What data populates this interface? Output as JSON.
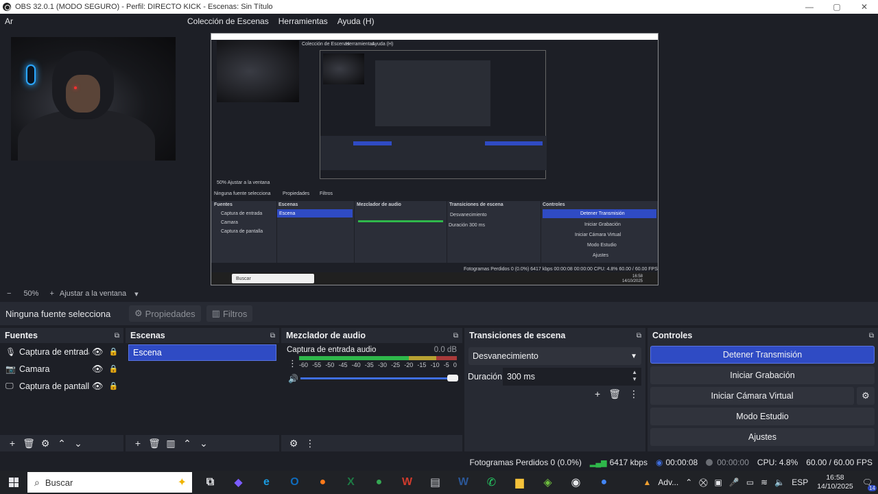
{
  "window": {
    "title": "OBS 32.0.1 (MODO SEGURO) - Perfil: DIRECTO KICK - Escenas: Sin Título",
    "minimize": "—",
    "maximize": "▢",
    "close": "✕"
  },
  "menu": {
    "items": [
      "Ar",
      "Colección de Escenas",
      "Herramientas",
      "Ayuda (H)"
    ]
  },
  "preview": {
    "nested": {
      "menu": [
        "Colección de Escenas",
        "Herramientas",
        "Ayuda (H)"
      ],
      "no_source": "Ninguna fuente selecciona",
      "properties": "Propiedades",
      "filters": "Filtros",
      "docks": [
        "Fuentes",
        "Escenas",
        "Mezclador de audio",
        "Transiciones de escena",
        "Controles"
      ],
      "sources": [
        "Captura de entrada",
        "Camara",
        "Captura de pantalla"
      ],
      "scene": "Escena",
      "controls": [
        "Detener Transmisión",
        "Iniciar Grabación",
        "Iniciar Cámara Virtual",
        "Modo Estudio",
        "Ajustes"
      ],
      "transition": "Desvanecimiento",
      "duration_label": "Duración",
      "duration": "300 ms",
      "search": "Buscar",
      "status": "Fotogramas Perdidos 0 (0.0%)   6417 kbps   00:00:08   00:00:00   CPU: 4.8%   60.00 / 60.00 FPS",
      "zoom": "50%   Ajustar a la ventana",
      "clock_time": "16:58",
      "clock_date": "14/10/2025"
    }
  },
  "zoom": {
    "minus": "−",
    "level": "50%",
    "plus": "+",
    "fit": "Ajustar a la ventana",
    "arrow": "▾"
  },
  "source_bar": {
    "no_source": "Ninguna fuente selecciona",
    "properties": "Propiedades",
    "filters": "Filtros"
  },
  "docks": {
    "sources": {
      "title": "Fuentes",
      "items": [
        {
          "name": "Captura de entrada audio",
          "icon": "microphone-icon"
        },
        {
          "name": "Camara",
          "icon": "camera-icon"
        },
        {
          "name": "Captura de pantalla",
          "icon": "monitor-icon"
        }
      ]
    },
    "scenes": {
      "title": "Escenas",
      "items": [
        "Escena"
      ]
    },
    "mixer": {
      "title": "Mezclador de audio",
      "channel": "Captura de entrada audio",
      "db": "0.0 dB",
      "scale": [
        "-60",
        "-55",
        "-50",
        "-45",
        "-40",
        "-35",
        "-30",
        "-25",
        "-20",
        "-15",
        "-10",
        "-5",
        "0"
      ],
      "level": 0.78
    },
    "transitions": {
      "title": "Transiciones de escena",
      "selected": "Desvanecimiento",
      "duration_label": "Duración",
      "duration": "300 ms"
    },
    "controls": {
      "title": "Controles",
      "stop_stream": "Detener Transmisión",
      "start_recording": "Iniciar Grabación",
      "start_virtual_cam": "Iniciar Cámara Virtual",
      "studio_mode": "Modo Estudio",
      "settings": "Ajustes"
    }
  },
  "status": {
    "dropped_frames": "Fotogramas Perdidos 0 (0.0%)",
    "bitrate": "6417 kbps",
    "stream_time": "00:00:08",
    "record_time": "00:00:00",
    "cpu": "CPU: 4.8%",
    "fps": "60.00 / 60.00 FPS"
  },
  "taskbar": {
    "search_placeholder": "Buscar",
    "apps": [
      {
        "name": "task-view",
        "glyph": "⧉",
        "color": "#e6e7ea"
      },
      {
        "name": "copilot",
        "glyph": "◆",
        "color": "#7b5cff"
      },
      {
        "name": "edge",
        "glyph": "e",
        "color": "#1a9be0"
      },
      {
        "name": "outlook",
        "glyph": "O",
        "color": "#0f6cbd"
      },
      {
        "name": "firefox",
        "glyph": "●",
        "color": "#ff7a1a"
      },
      {
        "name": "excel",
        "glyph": "X",
        "color": "#1d7a44"
      },
      {
        "name": "chrome",
        "glyph": "●",
        "color": "#35a853"
      },
      {
        "name": "office",
        "glyph": "W",
        "color": "#d13b2c"
      },
      {
        "name": "files",
        "glyph": "▤",
        "color": "#c8cacf"
      },
      {
        "name": "word",
        "glyph": "W",
        "color": "#2b5797"
      },
      {
        "name": "whatsapp",
        "glyph": "✆",
        "color": "#25d366"
      },
      {
        "name": "explorer",
        "glyph": "▆",
        "color": "#f5c23a"
      },
      {
        "name": "layers-app",
        "glyph": "◈",
        "color": "#6fbf3f"
      },
      {
        "name": "obs",
        "glyph": "◉",
        "color": "#e6e7ea"
      },
      {
        "name": "chrome-2",
        "glyph": "●",
        "color": "#4285f4"
      }
    ],
    "warning_label": "Adv...",
    "language": "ESP",
    "time": "16:58",
    "date": "14/10/2025",
    "notifications": "14"
  }
}
